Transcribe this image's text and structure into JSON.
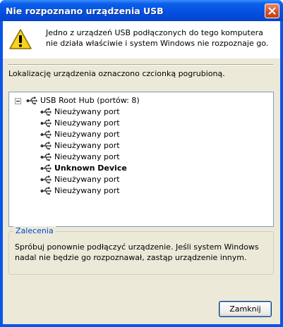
{
  "window": {
    "title": "Nie rozpoznano urządzenia USB"
  },
  "message": {
    "text": "Jedno z urządzeń USB podłączonych do tego komputera nie działa właściwie i system Windows nie rozpoznaje go."
  },
  "location_label": "Lokalizację urządzenia oznaczono czcionką pogrubioną.",
  "tree": {
    "root": "USB Root Hub (portów: 8)",
    "ports": [
      "Nieużywany port",
      "Nieużywany port",
      "Nieużywany port",
      "Nieużywany port",
      "Nieużywany port",
      "Unknown Device",
      "Nieużywany port",
      "Nieużywany port"
    ]
  },
  "recommendations": {
    "title": "Zalecenia",
    "text": "Spróbuj ponownie podłączyć urządzenie. Jeśli system Windows nadal nie będzie go rozpoznawał, zastąp urządzenie innym."
  },
  "buttons": {
    "close_label": "Zamknij"
  },
  "colors": {
    "titlebar": "#0553e3",
    "dialog_face": "#ece9d8",
    "group_title": "#0046d5"
  }
}
